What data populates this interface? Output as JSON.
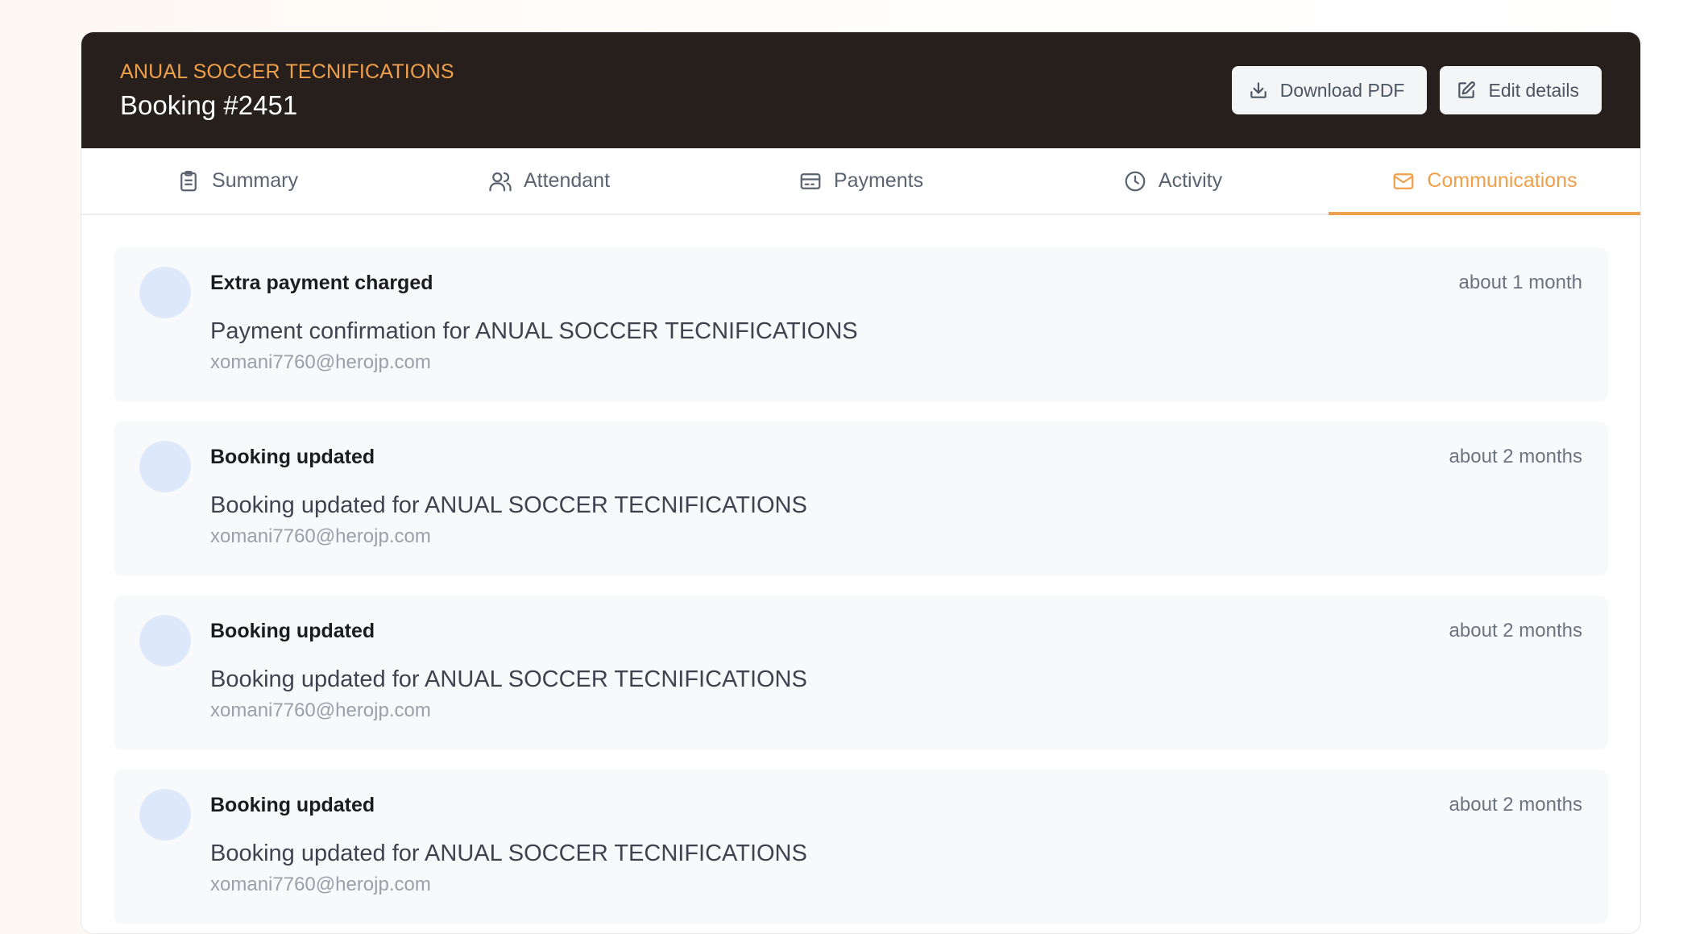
{
  "header": {
    "event_name": "ANUAL SOCCER TECNIFICATIONS",
    "booking_title": "Booking #2451",
    "download_label": "Download PDF",
    "edit_label": "Edit details"
  },
  "tabs": [
    {
      "label": "Summary",
      "icon": "clipboard-icon"
    },
    {
      "label": "Attendant",
      "icon": "users-icon"
    },
    {
      "label": "Payments",
      "icon": "credit-card-icon"
    },
    {
      "label": "Activity",
      "icon": "clock-icon"
    },
    {
      "label": "Communications",
      "icon": "mail-icon",
      "active": true
    }
  ],
  "communications": [
    {
      "title": "Extra payment charged",
      "time": "about 1 month",
      "subject": "Payment confirmation for ANUAL SOCCER TECNIFICATIONS",
      "email": "xomani7760@herojp.com"
    },
    {
      "title": "Booking updated",
      "time": "about 2 months",
      "subject": "Booking updated for ANUAL SOCCER TECNIFICATIONS",
      "email": "xomani7760@herojp.com"
    },
    {
      "title": "Booking updated",
      "time": "about 2 months",
      "subject": "Booking updated for ANUAL SOCCER TECNIFICATIONS",
      "email": "xomani7760@herojp.com"
    },
    {
      "title": "Booking updated",
      "time": "about 2 months",
      "subject": "Booking updated for ANUAL SOCCER TECNIFICATIONS",
      "email": "xomani7760@herojp.com"
    }
  ],
  "colors": {
    "header_bg": "#261f1c",
    "accent": "#f0a04b",
    "avatar_bg": "#dde8fb",
    "item_bg": "#f8f9fb"
  }
}
